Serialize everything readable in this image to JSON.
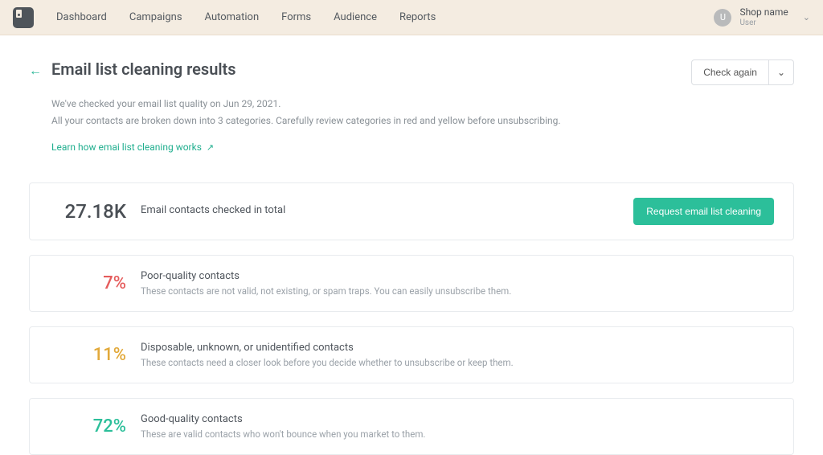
{
  "nav": {
    "items": [
      "Dashboard",
      "Campaigns",
      "Automation",
      "Forms",
      "Audience",
      "Reports"
    ]
  },
  "user": {
    "avatar_letter": "U",
    "shop_name": "Shop name",
    "role": "User"
  },
  "header": {
    "title": "Email list cleaning results",
    "check_again_label": "Check again",
    "sub_line1": "We've checked your email list quality on Jun 29, 2021.",
    "sub_line2": "All your contacts are broken down into 3 categories. Carefully review categories in red and yellow before unsubscribing.",
    "learn_link": "Learn how emai list cleaning works"
  },
  "total_card": {
    "value": "27.18K",
    "label": "Email contacts checked in total",
    "cta_label": "Request email list cleaning"
  },
  "categories": [
    {
      "pct": "7%",
      "color": "red",
      "title": "Poor-quality contacts",
      "desc": "These contacts are not valid, not existing, or spam traps. You can easily unsubscribe them."
    },
    {
      "pct": "11%",
      "color": "yellow",
      "title": "Disposable, unknown, or unidentified contacts",
      "desc": "These contacts need a closer look before you decide whether to unsubscribe or keep them."
    },
    {
      "pct": "72%",
      "color": "green",
      "title": "Good-quality contacts",
      "desc": "These are valid contacts who won't bounce when you market to them."
    }
  ]
}
